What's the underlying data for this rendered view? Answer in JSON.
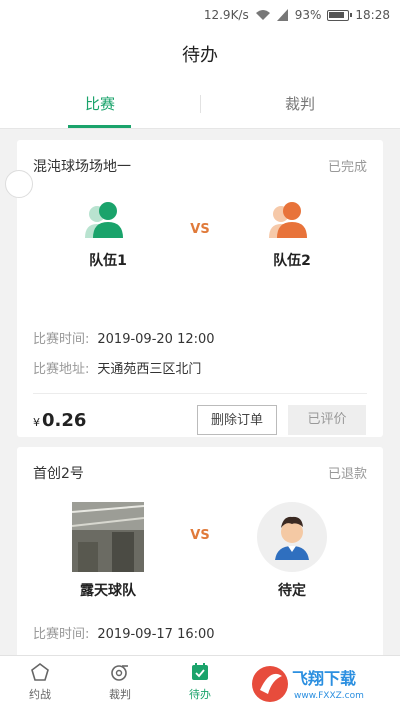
{
  "statusbar": {
    "speed": "12.9K/s",
    "battery": "93%",
    "time": "18:28"
  },
  "header": {
    "title": "待办"
  },
  "tabs": [
    {
      "label": "比赛"
    },
    {
      "label": "裁判"
    }
  ],
  "cards": [
    {
      "venue": "混沌球场场地一",
      "status": "已完成",
      "vs": "VS",
      "team1": "队伍1",
      "team2": "队伍2",
      "time_label": "比赛时间:",
      "time_value": "2019-09-20 12:00",
      "addr_label": "比赛地址:",
      "addr_value": "天通苑西三区北门",
      "currency": "¥",
      "price": "0.26",
      "delete_label": "删除订单",
      "review_label": "已评价"
    },
    {
      "venue": "首创2号",
      "status": "已退款",
      "vs": "VS",
      "team1": "露天球队",
      "team2": "待定",
      "time_label": "比赛时间:",
      "time_value": "2019-09-17 16:00"
    }
  ],
  "bottomnav": [
    {
      "label": "约战",
      "icon": "pentagon-icon"
    },
    {
      "label": "裁判",
      "icon": "whistle-icon"
    },
    {
      "label": "待办",
      "icon": "calendar-check-icon"
    },
    {
      "label": "",
      "icon": ""
    },
    {
      "label": "",
      "icon": ""
    }
  ],
  "watermark": {
    "line1": "飞翔下载",
    "line2": "www.FXXZ.com"
  },
  "colors": {
    "accent": "#1aa36b",
    "vs": "#e07a3a",
    "team1": "#1aa36b",
    "team2": "#e8733a"
  }
}
